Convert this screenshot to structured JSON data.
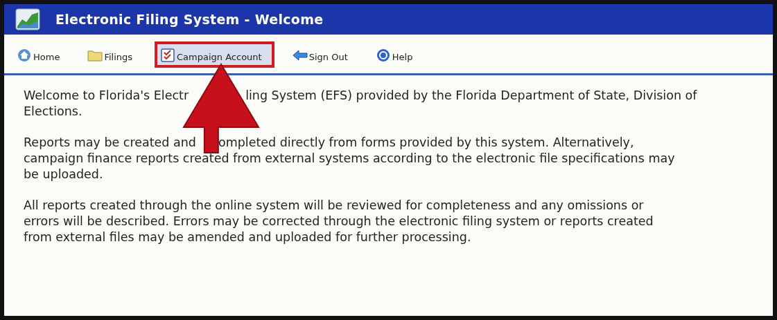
{
  "window": {
    "title": "Electronic Filing System - Welcome"
  },
  "nav": [
    {
      "label": "Home",
      "selected": false
    },
    {
      "label": "Filings",
      "selected": false
    },
    {
      "label": "Campaign Account",
      "selected": true
    },
    {
      "label": "Sign Out",
      "selected": false
    },
    {
      "label": "Help",
      "selected": false
    }
  ],
  "paragraphs": [
    {
      "lines": [
        [
          "Welcome to Florida's Electr",
          "ling System (EFS) provided by the Florida Department of State, Division of"
        ],
        [
          "Elections."
        ]
      ]
    },
    {
      "lines": [
        [
          "Reports may be created and",
          "ompleted directly from forms provided by this system. Alternatively,"
        ],
        [
          "campaign finance reports created from external systems according to the electronic file specifications may"
        ],
        [
          "be uploaded."
        ]
      ]
    },
    {
      "lines": [
        [
          "All reports created through the online system will be reviewed for completeness and any omissions or"
        ],
        [
          "errors will be described. Errors may be corrected through the electronic filing system or reports created"
        ],
        [
          "from external files may be amended and uploaded for further processing."
        ]
      ]
    }
  ]
}
